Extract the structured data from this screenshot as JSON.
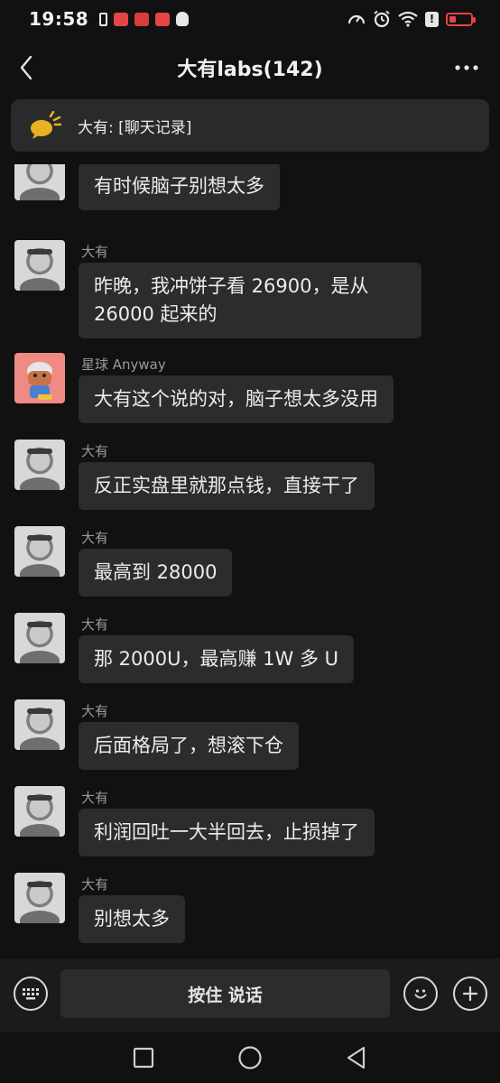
{
  "status_bar": {
    "time": "19:58",
    "alert_mark": "!",
    "battery_level": 0.3,
    "left_icons": [
      "battery-small-icon",
      "app-notification-icon",
      "app-notification-icon",
      "app-notification-icon",
      "qq-icon"
    ],
    "right_icons": [
      "speed-icon",
      "alarm-icon",
      "wifi-icon",
      "alert-icon",
      "battery-icon"
    ]
  },
  "header": {
    "title": "大有labs(142)",
    "back_icon": "chevron-left-icon",
    "more_icon": "more-dots-icon"
  },
  "pinned": {
    "icon": "announcement-icon",
    "text": "大有: [聊天记录]"
  },
  "messages": [
    {
      "sender": "",
      "text": "有时候脑子别想太多",
      "avatar": "photo"
    },
    {
      "sender": "大有",
      "text": "昨晚，我冲饼子看 26900，是从 26000 起来的",
      "avatar": "photo"
    },
    {
      "sender": "星球 Anyway",
      "text": "大有这个说的对，脑子想太多没用",
      "avatar": "cartoon"
    },
    {
      "sender": "大有",
      "text": "反正实盘里就那点钱，直接干了",
      "avatar": "photo"
    },
    {
      "sender": "大有",
      "text": "最高到 28000",
      "avatar": "photo"
    },
    {
      "sender": "大有",
      "text": "那 2000U，最高赚 1W 多 U",
      "avatar": "photo"
    },
    {
      "sender": "大有",
      "text": "后面格局了，想滚下仓",
      "avatar": "photo"
    },
    {
      "sender": "大有",
      "text": "利润回吐一大半回去，止损掉了",
      "avatar": "photo"
    },
    {
      "sender": "大有",
      "text": "别想太多",
      "avatar": "photo"
    }
  ],
  "input_bar": {
    "hold_to_talk_label": "按住 说话",
    "keyboard_icon": "keyboard-icon",
    "emoji_icon": "emoji-icon",
    "plus_icon": "plus-icon"
  },
  "nav_bar": {
    "icons": [
      "recent-apps-icon",
      "home-icon",
      "back-triangle-icon"
    ]
  },
  "colors": {
    "background": "#111111",
    "bubble": "#2c2c2c",
    "accent_red": "#e64545",
    "announcement_yellow": "#e8b31e"
  }
}
